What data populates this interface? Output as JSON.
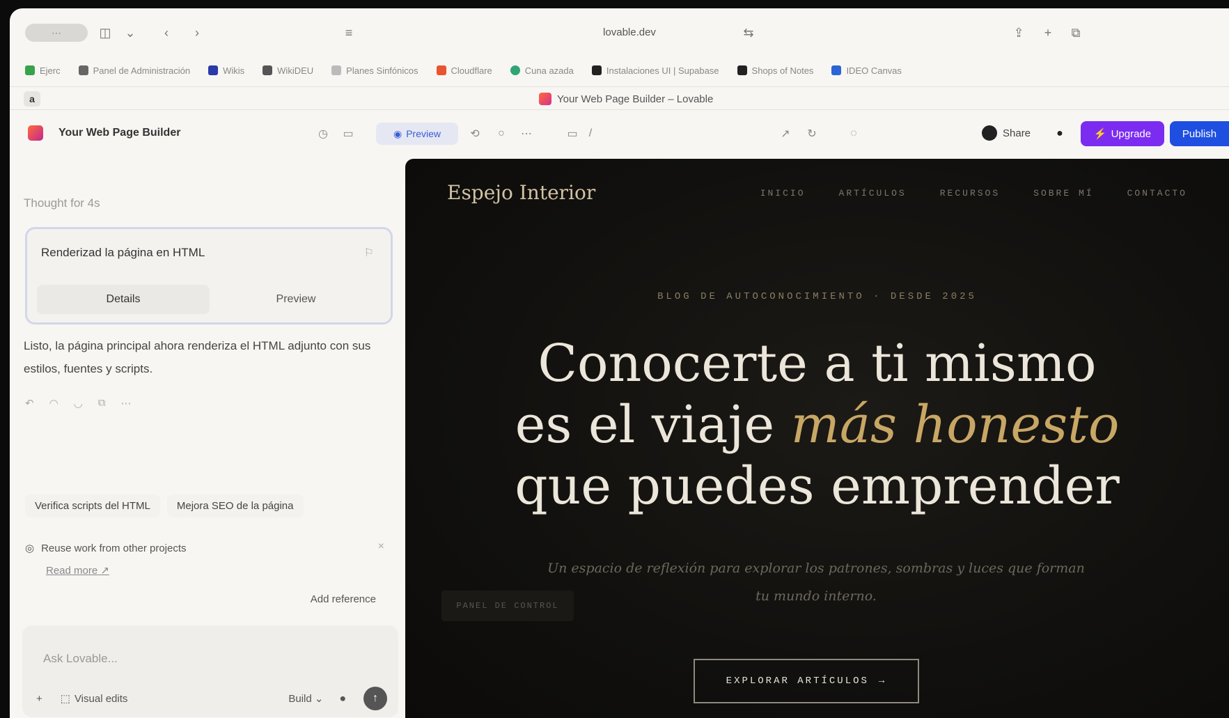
{
  "browser": {
    "url": "lovable.dev",
    "bookmarks": [
      {
        "label": "Ejerc",
        "color": "#37a34a"
      },
      {
        "label": "Panel de Administración",
        "color": "#666"
      },
      {
        "label": "Wikis",
        "color": "#2a3aa8"
      },
      {
        "label": "WikiDEU",
        "color": "#555"
      },
      {
        "label": "Planes Sinfónicos",
        "color": "#bbb"
      },
      {
        "label": "Cloudflare",
        "color": "#e8552f"
      },
      {
        "label": "Cuna azada",
        "color": "#2fa574"
      },
      {
        "label": "Instalaciones UI | Supabase",
        "color": "#222"
      },
      {
        "label": "Shops of Notes",
        "color": "#222"
      },
      {
        "label": "IDEO Canvas",
        "color": "#2a64d6"
      }
    ],
    "tab_title": "Your Web Page Builder – Lovable",
    "profile_letter": "a"
  },
  "app": {
    "project_name": "Your Web Page Builder",
    "preview_label": "Preview",
    "share_label": "Share",
    "upgrade_label": "Upgrade",
    "publish_label": "Publish"
  },
  "chat": {
    "thought_label": "Thought for 4s",
    "card_title": "Renderizad la página en HTML",
    "details_label": "Details",
    "preview_label": "Preview",
    "message": "Listo, la página principal ahora renderiza el HTML adjunto con sus estilos, fuentes y scripts.",
    "suggestions": [
      "Verifica scripts del HTML",
      "Mejora SEO de la página"
    ],
    "reuse_title": "Reuse work from other projects",
    "read_more": "Read more",
    "add_reference": "Add reference",
    "input_placeholder": "Ask Lovable...",
    "visual_edits": "Visual edits",
    "build_label": "Build"
  },
  "site": {
    "logo": "Espejo Interior",
    "nav": [
      "INICIO",
      "ARTÍCULOS",
      "RECURSOS",
      "SOBRE MÍ",
      "CONTACTO"
    ],
    "kicker": "BLOG DE AUTOCONOCIMIENTO · DESDE 2025",
    "headline_1": "Conocerte a ti mismo",
    "headline_2a": "es el viaje ",
    "headline_2b": "más honesto",
    "headline_3": "que puedes emprender",
    "subtitle": "Un espacio de reflexión para explorar los patrones, sombras y luces que forman tu mundo interno.",
    "panel_label": "PANEL DE CONTROL",
    "cta_label": "EXPLORAR ARTÍCULOS",
    "cta_arrow": "→"
  }
}
